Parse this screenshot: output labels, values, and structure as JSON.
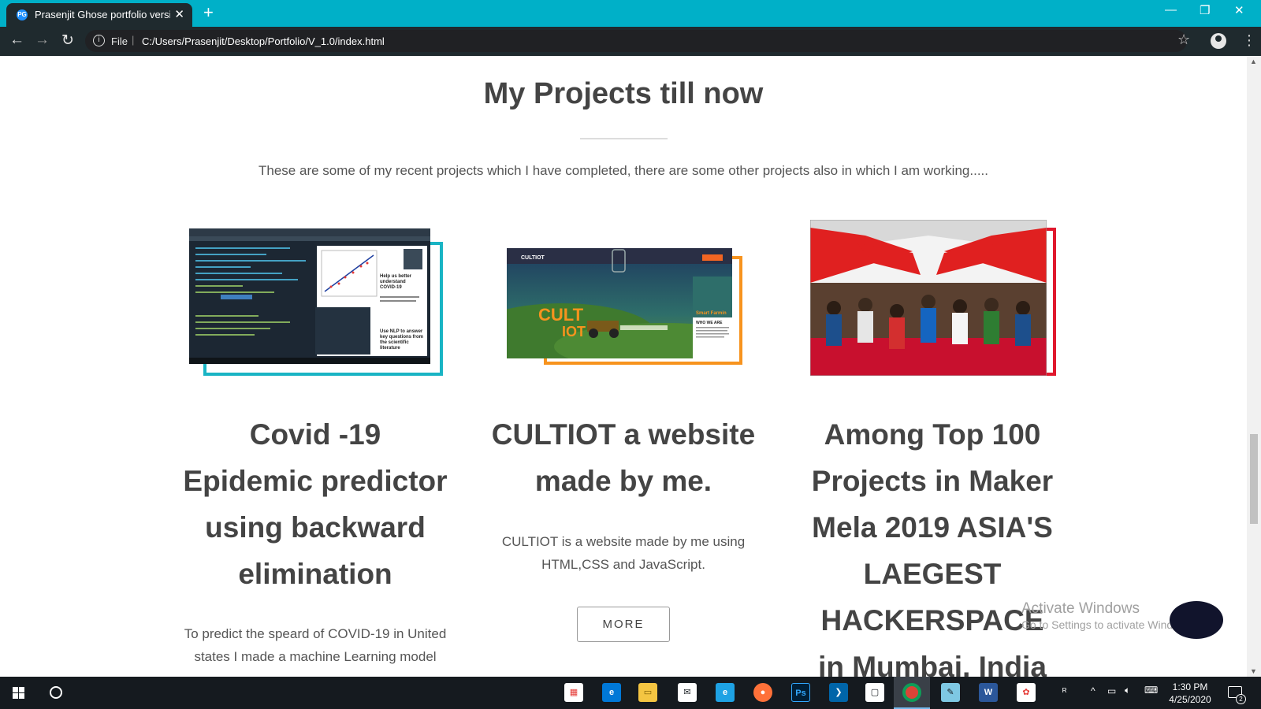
{
  "browser": {
    "tab_title": "Prasenjit Ghose portfolio version",
    "favicon_text": "PG",
    "new_tab": "+",
    "url_scheme": "File",
    "url": "C:/Users/Prasenjit/Desktop/Portfolio/V_1.0/index.html"
  },
  "page": {
    "heading": "My Projects till now",
    "subtitle": "These are some of my recent projects which I have completed, there are some other projects also in which I am working.....",
    "projects": [
      {
        "title": "Covid -19 Epidemic predictor using backward elimination",
        "description": "To predict the speard of COVID-19 in United states I made a machine Learning model",
        "frame_color": "#19b4c4",
        "image_texts": [
          "Help us better understand COVID-19",
          "Use NLP to answer key questions from the scientific literature"
        ]
      },
      {
        "title": "CULTIOT a website made by me.",
        "description": "CULTIOT is a website made by me using HTML,CSS and JavaScript.",
        "more_label": "MORE",
        "frame_color": "#f7931e",
        "image_texts": [
          "CULTIOT",
          "CULT",
          "IOT",
          "Smart Farmin",
          "WHO WE ARE"
        ]
      },
      {
        "title": "Among Top 100 Projects in Maker Mela 2019 ASIA'S LAEGEST HACKERSPACE in Mumbai, India",
        "description": "",
        "frame_color": "#e0182d"
      }
    ]
  },
  "activation": {
    "title": "Activate Windows",
    "subtitle": "Go to Settings to activate Windows."
  },
  "taskbar": {
    "time": "1:30 PM",
    "date": "4/25/2020",
    "notification_count": "2",
    "apps": [
      "store",
      "edge",
      "file-explorer",
      "mail",
      "internet-explorer",
      "firefox",
      "photoshop",
      "vscode",
      "terminal",
      "chrome",
      "notepad",
      "word",
      "paint"
    ]
  }
}
